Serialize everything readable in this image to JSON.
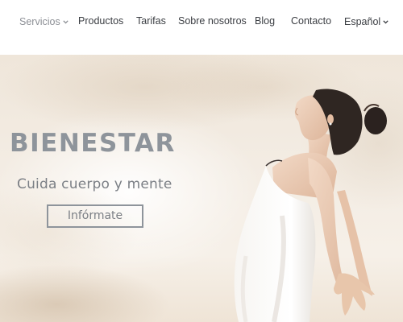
{
  "nav": {
    "items": [
      {
        "label": "Servicios",
        "has_dropdown": true,
        "active": true
      },
      {
        "label": "Productos",
        "has_dropdown": false
      },
      {
        "label": "Tarifas",
        "has_dropdown": false
      },
      {
        "label": "Sobre nosotros",
        "has_dropdown": false
      },
      {
        "label": "Blog",
        "has_dropdown": false
      },
      {
        "label": "Contacto",
        "has_dropdown": false
      },
      {
        "label": "Español",
        "has_dropdown": true
      }
    ],
    "chevron_glyph": "⌄"
  },
  "hero": {
    "title": "BIENESTAR",
    "subtitle": "Cuida cuerpo y mente",
    "button_label": "Infórmate",
    "image": "woman-stretching-sky-photo"
  },
  "colors": {
    "nav_text": "#3a3d42",
    "nav_active_text": "#8c8f95",
    "hero_title": "#8e949b",
    "hero_subtitle": "#7b7f85",
    "hero_background": "#f3ece3"
  }
}
